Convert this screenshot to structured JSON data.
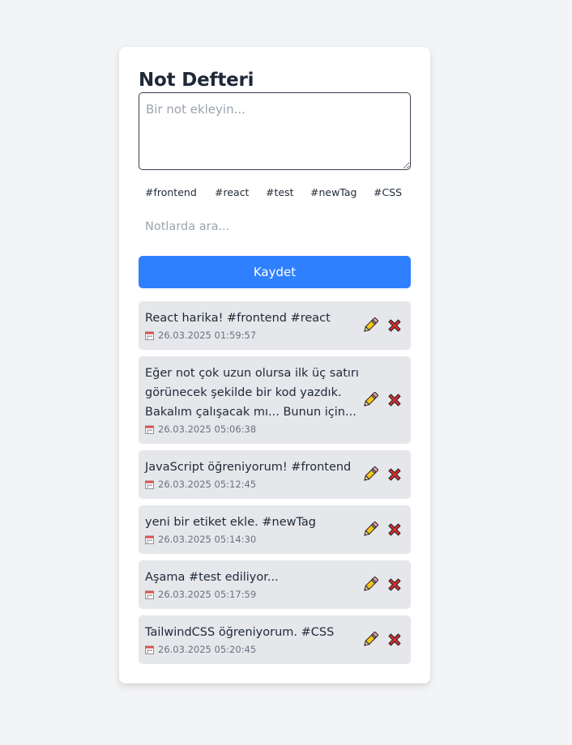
{
  "app": {
    "title": "Not Defteri"
  },
  "editor": {
    "placeholder": "Bir not ekleyin..."
  },
  "tags": [
    "#frontend",
    "#react",
    "#test",
    "#newTag",
    "#CSS"
  ],
  "search": {
    "placeholder": "Notlarda ara..."
  },
  "save_button": {
    "label": "Kaydet"
  },
  "colors": {
    "background": "#f3f4f6",
    "card": "#ffffff",
    "accent": "#2f80ff",
    "note_background": "#e5e7eb",
    "delete_icon": "#d32f2f",
    "edit_icon": "#f5c518"
  },
  "icons": {
    "date": "calendar-icon",
    "edit": "pencil-icon",
    "delete": "cross-mark-icon"
  },
  "notes": [
    {
      "lines": [
        "React harika! #frontend #react"
      ],
      "date": "26.03.2025 01:59:57"
    },
    {
      "lines": [
        "Eğer not çok uzun olursa ilk üç satırı",
        "görünecek şekilde bir kod yazdık.",
        "Bakalım çalışacak mı... Bunun için..."
      ],
      "date": "26.03.2025 05:06:38"
    },
    {
      "lines": [
        "JavaScript öğreniyorum! #frontend"
      ],
      "date": "26.03.2025 05:12:45"
    },
    {
      "lines": [
        "yeni bir etiket ekle. #newTag"
      ],
      "date": "26.03.2025 05:14:30"
    },
    {
      "lines": [
        "Aşama #test ediliyor..."
      ],
      "date": "26.03.2025 05:17:59"
    },
    {
      "lines": [
        "TailwindCSS öğreniyorum. #CSS"
      ],
      "date": "26.03.2025 05:20:45"
    }
  ]
}
